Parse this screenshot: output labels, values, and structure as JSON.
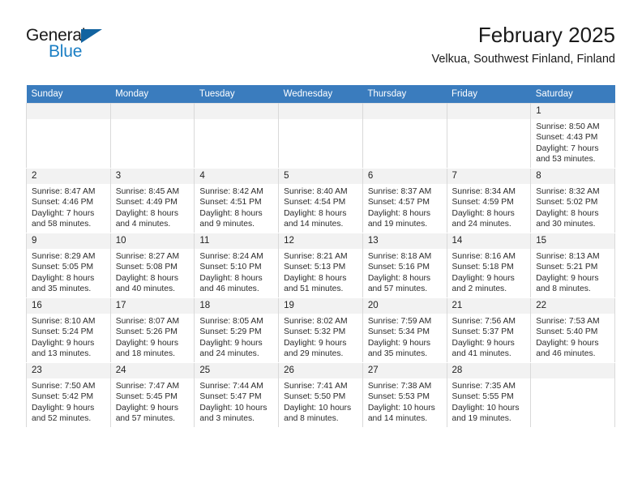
{
  "brand": {
    "name_part1": "General",
    "name_part2": "Blue",
    "logo_icon": "triangle-logo-icon"
  },
  "header": {
    "title": "February 2025",
    "subtitle": "Velkua, Southwest Finland, Finland"
  },
  "calendar": {
    "weekday_headers": [
      "Sunday",
      "Monday",
      "Tuesday",
      "Wednesday",
      "Thursday",
      "Friday",
      "Saturday"
    ],
    "accent_color": "#3a7cbe",
    "daynum_bg": "#f2f2f2",
    "weeks": [
      [
        {
          "day": "",
          "empty": true
        },
        {
          "day": "",
          "empty": true
        },
        {
          "day": "",
          "empty": true
        },
        {
          "day": "",
          "empty": true
        },
        {
          "day": "",
          "empty": true
        },
        {
          "day": "",
          "empty": true
        },
        {
          "day": "1",
          "sunrise": "Sunrise: 8:50 AM",
          "sunset": "Sunset: 4:43 PM",
          "daylight": "Daylight: 7 hours and 53 minutes."
        }
      ],
      [
        {
          "day": "2",
          "sunrise": "Sunrise: 8:47 AM",
          "sunset": "Sunset: 4:46 PM",
          "daylight": "Daylight: 7 hours and 58 minutes."
        },
        {
          "day": "3",
          "sunrise": "Sunrise: 8:45 AM",
          "sunset": "Sunset: 4:49 PM",
          "daylight": "Daylight: 8 hours and 4 minutes."
        },
        {
          "day": "4",
          "sunrise": "Sunrise: 8:42 AM",
          "sunset": "Sunset: 4:51 PM",
          "daylight": "Daylight: 8 hours and 9 minutes."
        },
        {
          "day": "5",
          "sunrise": "Sunrise: 8:40 AM",
          "sunset": "Sunset: 4:54 PM",
          "daylight": "Daylight: 8 hours and 14 minutes."
        },
        {
          "day": "6",
          "sunrise": "Sunrise: 8:37 AM",
          "sunset": "Sunset: 4:57 PM",
          "daylight": "Daylight: 8 hours and 19 minutes."
        },
        {
          "day": "7",
          "sunrise": "Sunrise: 8:34 AM",
          "sunset": "Sunset: 4:59 PM",
          "daylight": "Daylight: 8 hours and 24 minutes."
        },
        {
          "day": "8",
          "sunrise": "Sunrise: 8:32 AM",
          "sunset": "Sunset: 5:02 PM",
          "daylight": "Daylight: 8 hours and 30 minutes."
        }
      ],
      [
        {
          "day": "9",
          "sunrise": "Sunrise: 8:29 AM",
          "sunset": "Sunset: 5:05 PM",
          "daylight": "Daylight: 8 hours and 35 minutes."
        },
        {
          "day": "10",
          "sunrise": "Sunrise: 8:27 AM",
          "sunset": "Sunset: 5:08 PM",
          "daylight": "Daylight: 8 hours and 40 minutes."
        },
        {
          "day": "11",
          "sunrise": "Sunrise: 8:24 AM",
          "sunset": "Sunset: 5:10 PM",
          "daylight": "Daylight: 8 hours and 46 minutes."
        },
        {
          "day": "12",
          "sunrise": "Sunrise: 8:21 AM",
          "sunset": "Sunset: 5:13 PM",
          "daylight": "Daylight: 8 hours and 51 minutes."
        },
        {
          "day": "13",
          "sunrise": "Sunrise: 8:18 AM",
          "sunset": "Sunset: 5:16 PM",
          "daylight": "Daylight: 8 hours and 57 minutes."
        },
        {
          "day": "14",
          "sunrise": "Sunrise: 8:16 AM",
          "sunset": "Sunset: 5:18 PM",
          "daylight": "Daylight: 9 hours and 2 minutes."
        },
        {
          "day": "15",
          "sunrise": "Sunrise: 8:13 AM",
          "sunset": "Sunset: 5:21 PM",
          "daylight": "Daylight: 9 hours and 8 minutes."
        }
      ],
      [
        {
          "day": "16",
          "sunrise": "Sunrise: 8:10 AM",
          "sunset": "Sunset: 5:24 PM",
          "daylight": "Daylight: 9 hours and 13 minutes."
        },
        {
          "day": "17",
          "sunrise": "Sunrise: 8:07 AM",
          "sunset": "Sunset: 5:26 PM",
          "daylight": "Daylight: 9 hours and 18 minutes."
        },
        {
          "day": "18",
          "sunrise": "Sunrise: 8:05 AM",
          "sunset": "Sunset: 5:29 PM",
          "daylight": "Daylight: 9 hours and 24 minutes."
        },
        {
          "day": "19",
          "sunrise": "Sunrise: 8:02 AM",
          "sunset": "Sunset: 5:32 PM",
          "daylight": "Daylight: 9 hours and 29 minutes."
        },
        {
          "day": "20",
          "sunrise": "Sunrise: 7:59 AM",
          "sunset": "Sunset: 5:34 PM",
          "daylight": "Daylight: 9 hours and 35 minutes."
        },
        {
          "day": "21",
          "sunrise": "Sunrise: 7:56 AM",
          "sunset": "Sunset: 5:37 PM",
          "daylight": "Daylight: 9 hours and 41 minutes."
        },
        {
          "day": "22",
          "sunrise": "Sunrise: 7:53 AM",
          "sunset": "Sunset: 5:40 PM",
          "daylight": "Daylight: 9 hours and 46 minutes."
        }
      ],
      [
        {
          "day": "23",
          "sunrise": "Sunrise: 7:50 AM",
          "sunset": "Sunset: 5:42 PM",
          "daylight": "Daylight: 9 hours and 52 minutes."
        },
        {
          "day": "24",
          "sunrise": "Sunrise: 7:47 AM",
          "sunset": "Sunset: 5:45 PM",
          "daylight": "Daylight: 9 hours and 57 minutes."
        },
        {
          "day": "25",
          "sunrise": "Sunrise: 7:44 AM",
          "sunset": "Sunset: 5:47 PM",
          "daylight": "Daylight: 10 hours and 3 minutes."
        },
        {
          "day": "26",
          "sunrise": "Sunrise: 7:41 AM",
          "sunset": "Sunset: 5:50 PM",
          "daylight": "Daylight: 10 hours and 8 minutes."
        },
        {
          "day": "27",
          "sunrise": "Sunrise: 7:38 AM",
          "sunset": "Sunset: 5:53 PM",
          "daylight": "Daylight: 10 hours and 14 minutes."
        },
        {
          "day": "28",
          "sunrise": "Sunrise: 7:35 AM",
          "sunset": "Sunset: 5:55 PM",
          "daylight": "Daylight: 10 hours and 19 minutes."
        },
        {
          "day": "",
          "empty": true
        }
      ]
    ]
  }
}
